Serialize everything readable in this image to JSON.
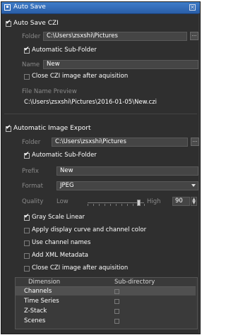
{
  "title": "Auto Save",
  "auto_save_czi": {
    "checkbox_label": "Auto Save CZI",
    "checked": true,
    "folder_label": "Folder",
    "folder_value": "C:\\Users\\zsxshi\\Pictures",
    "browse_label": "...",
    "auto_subfolder_label": "Automatic Sub-Folder",
    "auto_subfolder_checked": true,
    "name_label": "Name",
    "name_value": "New",
    "close_czi_label": "Close CZI image after aquisition",
    "close_czi_checked": false,
    "preview_label": "File Name Preview",
    "preview_value": "C:\\Users\\zsxshi\\Pictures\\2016-01-05\\New.czi"
  },
  "auto_export": {
    "checkbox_label": "Automatic Image Export",
    "checked": true,
    "folder_label": "Folder",
    "folder_value": "C:\\Users\\zsxshi\\Pictures",
    "browse_label": "...",
    "auto_subfolder_label": "Automatic Sub-Folder",
    "auto_subfolder_checked": true,
    "prefix_label": "Prefix",
    "prefix_value": "New",
    "format_label": "Format",
    "format_value": "JPEG",
    "quality_label": "Quality",
    "quality_low": "Low",
    "quality_high": "High",
    "quality_value": "90",
    "quality_fraction": 0.9,
    "options": [
      {
        "label": "Gray Scale Linear",
        "checked": true
      },
      {
        "label": "Apply display curve and channel color",
        "checked": false
      },
      {
        "label": "Use channel names",
        "checked": false
      },
      {
        "label": "Add XML Metadata",
        "checked": false
      },
      {
        "label": "Close CZI image after aquisition",
        "checked": false
      }
    ]
  },
  "dimension_table": {
    "col_dimension": "Dimension",
    "col_subdirectory": "Sub-directory",
    "rows": [
      {
        "label": "Channels",
        "checked": false
      },
      {
        "label": "Time Series",
        "checked": false
      },
      {
        "label": "Z-Stack",
        "checked": false
      },
      {
        "label": "Scenes",
        "checked": false
      }
    ]
  }
}
